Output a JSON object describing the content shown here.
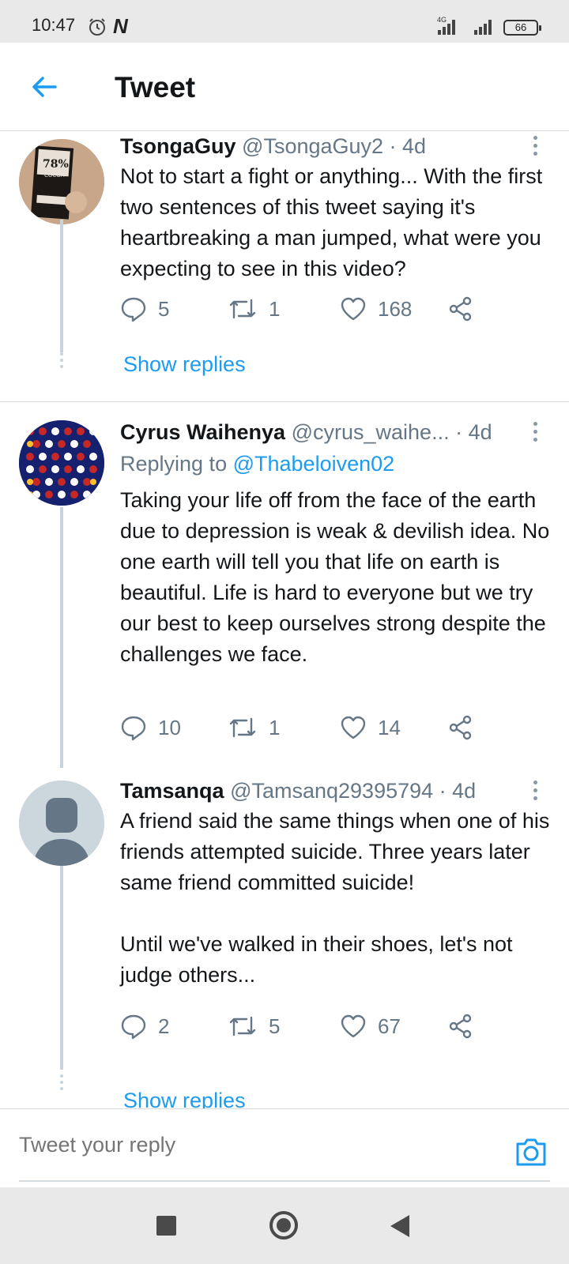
{
  "status_bar": {
    "time": "10:47",
    "network": "4G",
    "battery": "66"
  },
  "header": {
    "title": "Tweet"
  },
  "tweets": [
    {
      "name": "TsongaGuy",
      "handle": "@TsongaGuy2 · 4d",
      "body": "Not to start a fight or anything... With the first two sentences of this tweet saying it's heartbreaking a man jumped, what were you expecting to see in this video?",
      "replies": "5",
      "retweets": "1",
      "likes": "168",
      "show_replies": "Show replies"
    },
    {
      "name": "Cyrus Waihenya",
      "handle": "@cyrus_waihe... · 4d",
      "replying_prefix": "Replying to",
      "replying_to": "@Thabeloiven02",
      "body": "Taking your life off from the face of the earth due to depression is weak & devilish idea. No one earth will tell you that life on earth is beautiful. Life is hard to everyone but we try our best to keep ourselves strong despite the challenges we face.",
      "replies": "10",
      "retweets": "1",
      "likes": "14"
    },
    {
      "name": "Tamsanqa",
      "handle": "@Tamsanq29395794 · 4d",
      "body": "A friend said the same things when one of his friends attempted suicide. Three years later same friend committed suicide!\n\nUntil we've walked in their shoes, let's not judge others...",
      "replies": "2",
      "retweets": "5",
      "likes": "67",
      "show_replies": "Show replies"
    }
  ],
  "reply_bar": {
    "placeholder": "Tweet your reply"
  },
  "colors": {
    "accent": "#1d9bf0",
    "muted": "#657786",
    "thread_line": "#c9d3dc"
  },
  "icons": [
    "alarm-icon",
    "signal-icon",
    "back-arrow-icon",
    "more-icon",
    "reply-icon",
    "retweet-icon",
    "like-icon",
    "share-icon",
    "camera-icon"
  ]
}
